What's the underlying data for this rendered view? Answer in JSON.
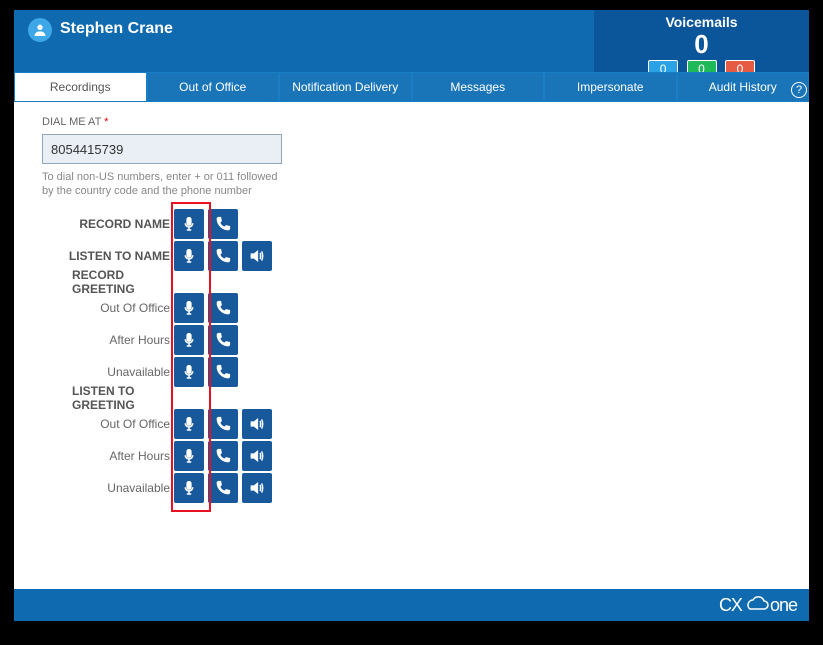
{
  "header": {
    "user_name": "Stephen Crane",
    "voicemails_label": "Voicemails",
    "voicemails_count": "0",
    "badges": {
      "blue": "0",
      "green": "0",
      "red": "0"
    }
  },
  "tabs": {
    "recordings": "Recordings",
    "out_of_office": "Out of Office",
    "notification_delivery": "Notification Delivery",
    "messages": "Messages",
    "impersonate": "Impersonate",
    "audit_history": "Audit History"
  },
  "help_glyph": "?",
  "dial": {
    "label": "DIAL ME AT",
    "required_mark": "*",
    "value": "8054415739",
    "hint": "To dial non-US numbers, enter + or 011 followed by the country code and the phone number"
  },
  "rows": {
    "record_name": "RECORD NAME",
    "listen_to_name": "LISTEN TO NAME",
    "record_greeting_header": "RECORD GREETING",
    "listen_greeting_header": "LISTEN TO GREETING",
    "out_of_office": "Out Of Office",
    "after_hours": "After Hours",
    "unavailable": "Unavailable"
  },
  "icons": {
    "mic": "microphone-icon",
    "phone": "phone-icon",
    "speaker": "speaker-icon"
  },
  "footer": {
    "brand_prefix": "CX",
    "brand_suffix": "one"
  }
}
